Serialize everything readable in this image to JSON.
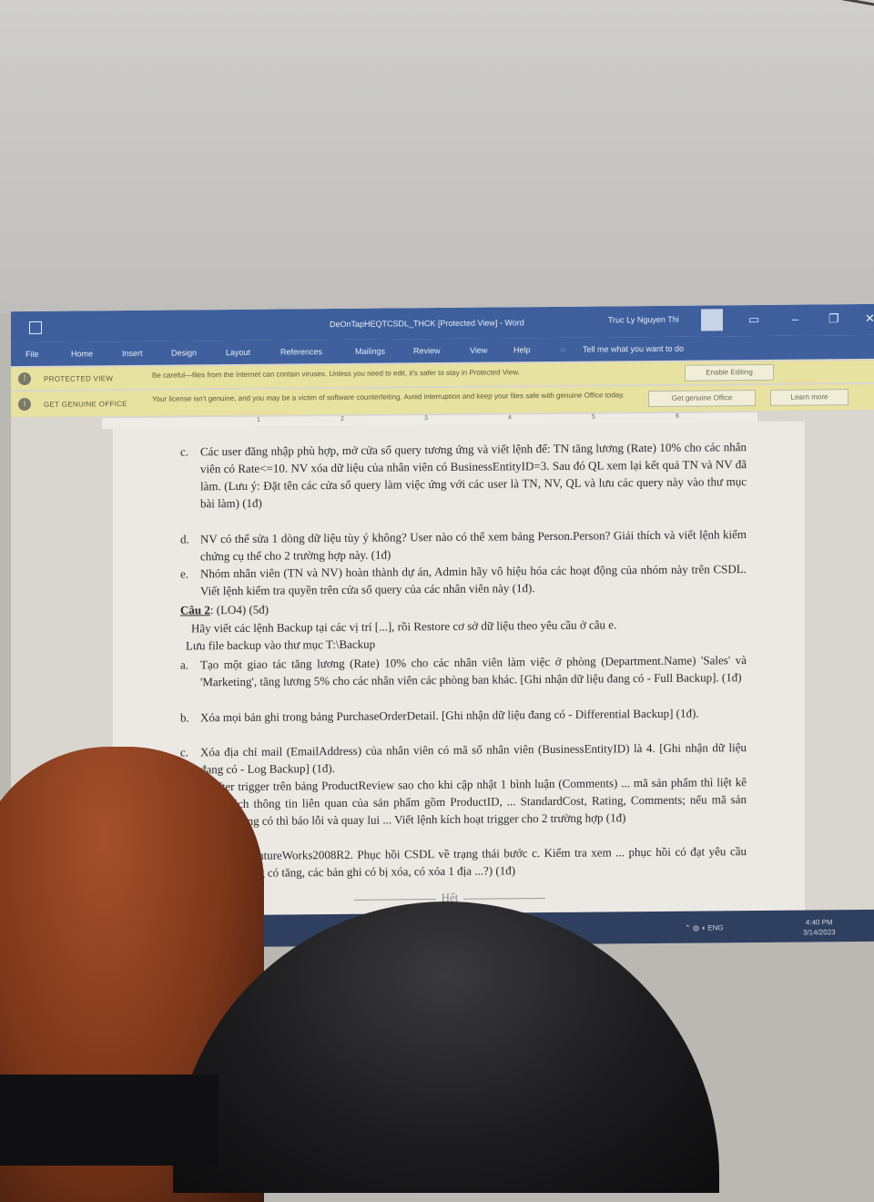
{
  "window": {
    "title": "DeOnTapHEQTCSDL_THCK [Protected View] - Word",
    "user": "Truc Ly Nguyen Thi"
  },
  "ribbon": {
    "tabs": [
      "File",
      "Home",
      "Insert",
      "Design",
      "Layout",
      "References",
      "Mailings",
      "Review",
      "View",
      "Help"
    ],
    "tell_me": "Tell me what you want to do"
  },
  "protected_bar": {
    "label": "PROTECTED VIEW",
    "message": "Be careful—files from the Internet can contain viruses. Unless you need to edit, it's safer to stay in Protected View.",
    "button": "Enable Editing"
  },
  "genuine_bar": {
    "label": "GET GENUINE OFFICE",
    "message": "Your license isn't genuine, and you may be a victim of software counterfeiting. Avoid interruption and keep your files safe with genuine Office today.",
    "button1": "Get genuine Office",
    "button2": "Learn more"
  },
  "ruler": [
    "1",
    "2",
    "3",
    "4",
    "5",
    "6"
  ],
  "document": {
    "item_c1": {
      "marker": "c.",
      "text": "Các user đăng nhập phù hợp, mở cửa sổ query tương ứng và viết lệnh để: TN tăng lương (Rate) 10% cho các nhân viên có Rate<=10. NV xóa dữ liệu của nhân viên có BusinessEntityID=3. Sau đó QL xem lại kết quả TN và NV đã làm. (Lưu ý: Đặt tên các cửa sổ query làm việc ứng với các user là TN, NV, QL và lưu các query này vào thư mục bài làm) (1đ)"
    },
    "item_d1": {
      "marker": "d.",
      "text": "NV có thể sửa 1 dòng dữ liệu tùy ý không? User nào có thể xem bảng Person.Person? Giải thích và viết lệnh kiểm chứng cụ thể cho 2 trường hợp này. (1đ)"
    },
    "item_e1": {
      "marker": "e.",
      "text": "Nhóm nhân viên (TN và NV) hoàn thành dự án, Admin hãy vô hiệu hóa các hoạt động của nhóm này trên CSDL. Viết lệnh kiểm tra quyền trên cửa sổ query của các nhân viên này (1đ)."
    },
    "heading": {
      "label": "Câu 2",
      "tag": ": (LO4) (5đ)"
    },
    "intro1": "Hãy viết các lệnh Backup tại các vị trí [...], rồi Restore cơ sở dữ liệu theo yêu cầu ở câu e.",
    "intro2": "Lưu file backup vào thư mục T:\\Backup",
    "item_a2": {
      "marker": "a.",
      "text": "Tạo một giao tác tăng lương (Rate) 10% cho các nhân viên làm việc ở phòng (Department.Name) 'Sales' và 'Marketing', tăng lương 5% cho các nhân viên các phòng ban khác. [Ghi nhận dữ liệu đang có - Full Backup]. (1đ)"
    },
    "item_b2": {
      "marker": "b.",
      "text": "Xóa mọi bản ghi trong bảng PurchaseOrderDetail. [Ghi nhận dữ liệu đang có - Differential Backup] (1đ)."
    },
    "item_c2": {
      "marker": "c.",
      "text": "Xóa địa chỉ mail (EmailAddress) của nhân viên có mã số nhân viên (BusinessEntityID) là 4. [Ghi nhận dữ liệu đang có - Log Backup] (1đ)."
    },
    "item_d2": {
      "marker": "d.",
      "text": "... after trigger trên bảng ProductReview sao cho khi cập nhật 1 bình luận (Comments) ... mã sản phẩm thì liệt kê danh sách thông tin liên quan của sản phẩm gồm ProductID, ... StandardCost, Rating, Comments; nếu mã sản phẩm không có thì báo lỗi và quay lui ... Viết lệnh kích hoạt trigger cho 2 trường hợp (1đ)"
    },
    "item_e2": {
      "marker": "e.",
      "text": "... OL AdventureWorks2008R2. Phục hồi CSDL về trạng thái bước c. Kiểm tra xem ... phục hồi có đạt yêu cầu không (lương có tăng, các bản ghi có bị xóa, có xóa 1 địa ...?) (1đ)"
    },
    "end": "Hết"
  },
  "taskbar": {
    "lang": "ENG",
    "time": "4:40 PM",
    "date": "3/14/2023"
  }
}
